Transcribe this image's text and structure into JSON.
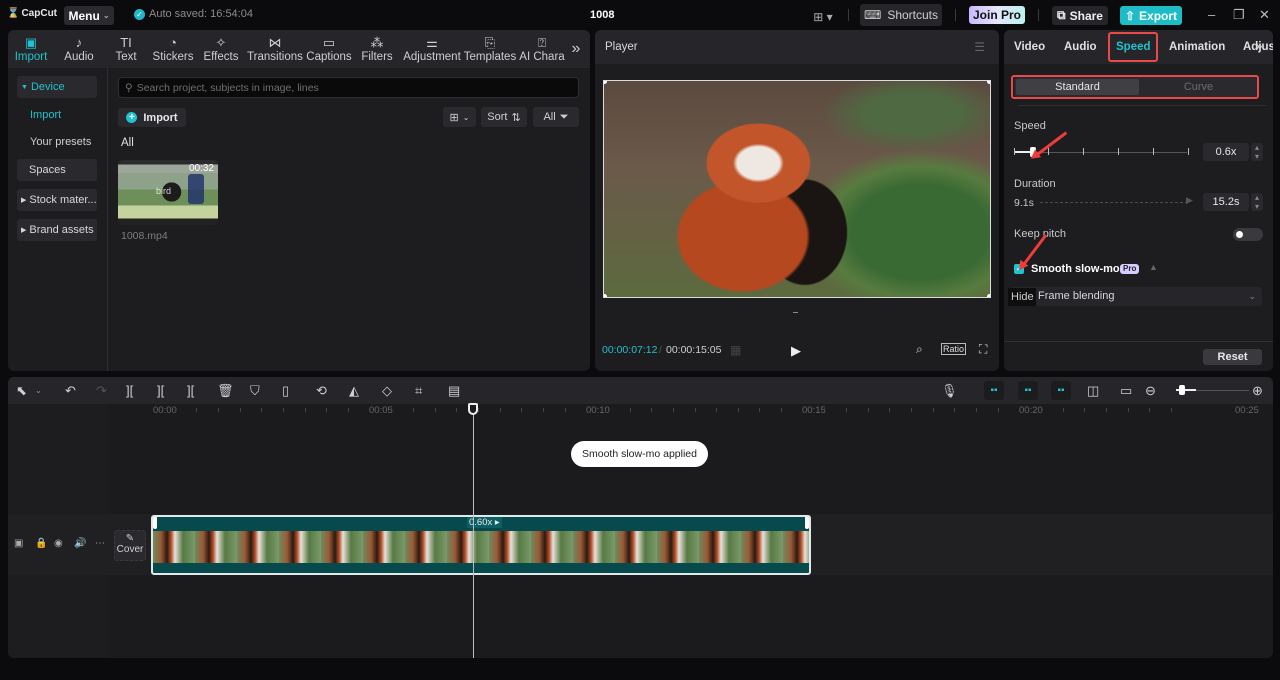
{
  "titlebar": {
    "app_name": "CapCut",
    "menu_label": "Menu",
    "autosave": "Auto saved: 16:54:04",
    "project_title": "1008",
    "shortcuts_label": "Shortcuts",
    "join_pro_label": "Join Pro",
    "share_label": "Share",
    "export_label": "Export"
  },
  "media_tabs": [
    {
      "label": "Import",
      "icon": "import-icon",
      "glyph": "▣",
      "active": true
    },
    {
      "label": "Audio",
      "icon": "audio-icon",
      "glyph": "♪"
    },
    {
      "label": "Text",
      "icon": "text-icon",
      "glyph": "TI"
    },
    {
      "label": "Stickers",
      "icon": "sticker-icon",
      "glyph": "◔"
    },
    {
      "label": "Effects",
      "icon": "effects-icon",
      "glyph": "✧"
    },
    {
      "label": "Transitions",
      "icon": "transitions-icon",
      "glyph": "⋈"
    },
    {
      "label": "Captions",
      "icon": "captions-icon",
      "glyph": "▭"
    },
    {
      "label": "Filters",
      "icon": "filters-icon",
      "glyph": "⁂"
    },
    {
      "label": "Adjustment",
      "icon": "adjustment-icon",
      "glyph": "⚌"
    },
    {
      "label": "Templates",
      "icon": "templates-icon",
      "glyph": "⎘"
    },
    {
      "label": "AI Chara",
      "icon": "ai-character-icon",
      "glyph": "⍰"
    }
  ],
  "more_tabs_glyph": "»",
  "sidebar": {
    "device": "Device",
    "import": "Import",
    "your_presets": "Your presets",
    "spaces": "Spaces",
    "stock": "Stock mater...",
    "brand": "Brand assets"
  },
  "media": {
    "search_placeholder": "Search project, subjects in image, lines",
    "import_label": "Import",
    "sort_label": "Sort",
    "filter_label": "All",
    "section_label": "All",
    "items": [
      {
        "name": "1008.mp4",
        "duration": "00:32",
        "overlay_text": "bird"
      }
    ]
  },
  "player": {
    "title": "Player",
    "current_time": "00:00:07:12",
    "separator": "/",
    "total_time": "00:00:15:05",
    "ratio_label": "Ratio"
  },
  "inspector": {
    "tabs": [
      {
        "label": "Video"
      },
      {
        "label": "Audio"
      },
      {
        "label": "Speed",
        "active": true
      },
      {
        "label": "Animation"
      },
      {
        "label": "Adjus"
      }
    ],
    "mode_standard": "Standard",
    "mode_curve": "Curve",
    "speed_label": "Speed",
    "speed_value": "0.6x",
    "speed_slider_fraction": 0.11,
    "duration_label": "Duration",
    "duration_original": "9.1s",
    "duration_value": "15.2s",
    "keep_pitch_label": "Keep pitch",
    "keep_pitch_on": false,
    "smooth_label": "Smooth slow-mo",
    "smooth_checked": true,
    "pro_badge": "Pro",
    "blending_value": "Frame blending",
    "hide_tooltip": "Hide",
    "reset_label": "Reset"
  },
  "timeline": {
    "ruler_labels": [
      "00:00",
      "00:05",
      "00:10",
      "00:15",
      "00:20",
      "00:25"
    ],
    "toast": "Smooth slow-mo applied",
    "clip_speed": "0.60x",
    "cover_label": "Cover",
    "zoom_fraction": 0.25,
    "playhead_time": "00:00:07:12"
  },
  "colors": {
    "accent": "#1fc2cf",
    "highlight": "#e84a4a",
    "clip": "#074a4e"
  }
}
